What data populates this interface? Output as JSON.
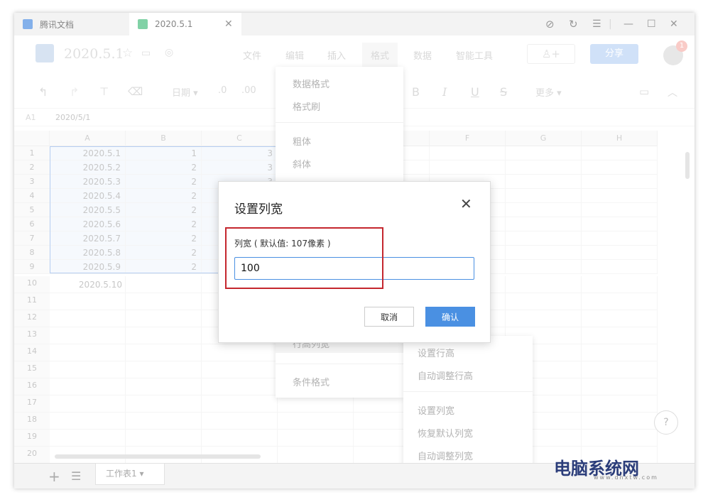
{
  "tabs": [
    {
      "label": "腾讯文档",
      "color": "#1e6fd9"
    },
    {
      "label": "2020.5.1",
      "color": "#1aad5d"
    }
  ],
  "window_controls": {
    "close_tab": "✕",
    "minimize": "—",
    "maximize": "☐",
    "close": "✕"
  },
  "doc": {
    "title": "2020.5.1",
    "share_label": "分享",
    "badge": "1"
  },
  "menu_items": [
    "文件",
    "编辑",
    "插入",
    "格式",
    "数据",
    "智能工具"
  ],
  "toolbar": {
    "date_label": "日期",
    "more_label": "更多"
  },
  "formula_bar": {
    "cell_ref": "A1",
    "value": "2020/5/1"
  },
  "columns": [
    "A",
    "B",
    "C",
    "D",
    "E",
    "F",
    "G",
    "H"
  ],
  "rows": [
    {
      "n": "1",
      "a": "2020.5.1",
      "b": "1",
      "c": "3"
    },
    {
      "n": "2",
      "a": "2020.5.2",
      "b": "2",
      "c": "3"
    },
    {
      "n": "3",
      "a": "2020.5.3",
      "b": "2",
      "c": "3"
    },
    {
      "n": "4",
      "a": "2020.5.4",
      "b": "2",
      "c": ""
    },
    {
      "n": "5",
      "a": "2020.5.5",
      "b": "2",
      "c": ""
    },
    {
      "n": "6",
      "a": "2020.5.6",
      "b": "2",
      "c": ""
    },
    {
      "n": "7",
      "a": "2020.5.7",
      "b": "2",
      "c": ""
    },
    {
      "n": "8",
      "a": "2020.5.8",
      "b": "2",
      "c": ""
    },
    {
      "n": "9",
      "a": "2020.5.9",
      "b": "2",
      "c": ""
    },
    {
      "n": "10",
      "a": "2020.5.10",
      "b": "",
      "c": ""
    },
    {
      "n": "11",
      "a": "",
      "b": "",
      "c": ""
    },
    {
      "n": "12",
      "a": "",
      "b": "",
      "c": ""
    },
    {
      "n": "13",
      "a": "",
      "b": "",
      "c": ""
    },
    {
      "n": "14",
      "a": "",
      "b": "",
      "c": ""
    },
    {
      "n": "15",
      "a": "",
      "b": "",
      "c": ""
    },
    {
      "n": "16",
      "a": "",
      "b": "",
      "c": ""
    },
    {
      "n": "17",
      "a": "",
      "b": "",
      "c": ""
    },
    {
      "n": "18",
      "a": "",
      "b": "",
      "c": ""
    },
    {
      "n": "19",
      "a": "",
      "b": "",
      "c": ""
    },
    {
      "n": "20",
      "a": "",
      "b": "",
      "c": ""
    }
  ],
  "format_menu": {
    "items": [
      "数据格式",
      "格式刷",
      "粗体",
      "斜体",
      "行高列宽",
      "条件格式"
    ]
  },
  "submenu": {
    "items": [
      "设置行高",
      "自动调整行高",
      "设置列宽",
      "恢复默认列宽",
      "自动调整列宽"
    ]
  },
  "dialog": {
    "title": "设置列宽",
    "label": "列宽 ( 默认值: 107像素 )",
    "value": "100",
    "cancel": "取消",
    "ok": "确认"
  },
  "sheet": {
    "tab_label": "工作表1"
  },
  "watermark": {
    "text": "电脑系统网",
    "sub": "www.dnxtw.com"
  },
  "colors": {
    "accent": "#4a90e2",
    "highlight_box": "#c4272e"
  }
}
